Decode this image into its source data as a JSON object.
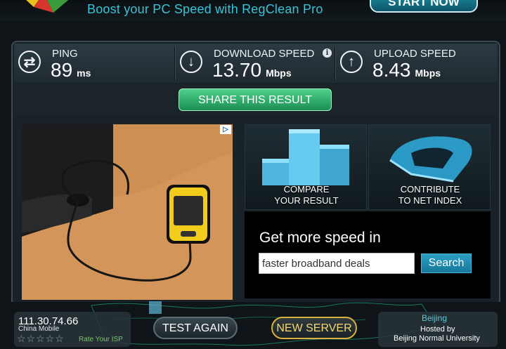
{
  "promo": {
    "text": "Boost your PC Speed with RegClean Pro",
    "start_button": "START NOW"
  },
  "stats": {
    "ping": {
      "label": "PING",
      "value": "89",
      "unit": "ms",
      "icon": "ping-arrows-icon"
    },
    "download": {
      "label": "DOWNLOAD SPEED",
      "value": "13.70",
      "unit": "Mbps",
      "icon": "download-arrow-icon",
      "info_icon": "info-icon"
    },
    "upload": {
      "label": "UPLOAD SPEED",
      "value": "8.43",
      "unit": "Mbps",
      "icon": "upload-arrow-icon"
    }
  },
  "share_button": "SHARE THIS RESULT",
  "tiles": {
    "compare": {
      "line1": "COMPARE",
      "line2": "YOUR RESULT"
    },
    "contribute": {
      "line1": "CONTRIBUTE",
      "line2": "TO NET INDEX"
    }
  },
  "speed_search": {
    "title": "Get more speed in",
    "input_value": "faster broadband deals",
    "button": "Search"
  },
  "client": {
    "ip": "111.30.74.66",
    "isp": "China Mobile",
    "stars": "☆☆☆☆☆",
    "rate_label": "Rate Your ISP"
  },
  "actions": {
    "test_again": "TEST AGAIN",
    "new_server": "NEW SERVER"
  },
  "server": {
    "city": "Beijing",
    "hosted_by": "Hosted by",
    "host": "Beijing Normal University"
  },
  "colors": {
    "accent": "#39c3d6",
    "share_green": "#2fb56e",
    "new_server_gold": "#d9b23b"
  }
}
